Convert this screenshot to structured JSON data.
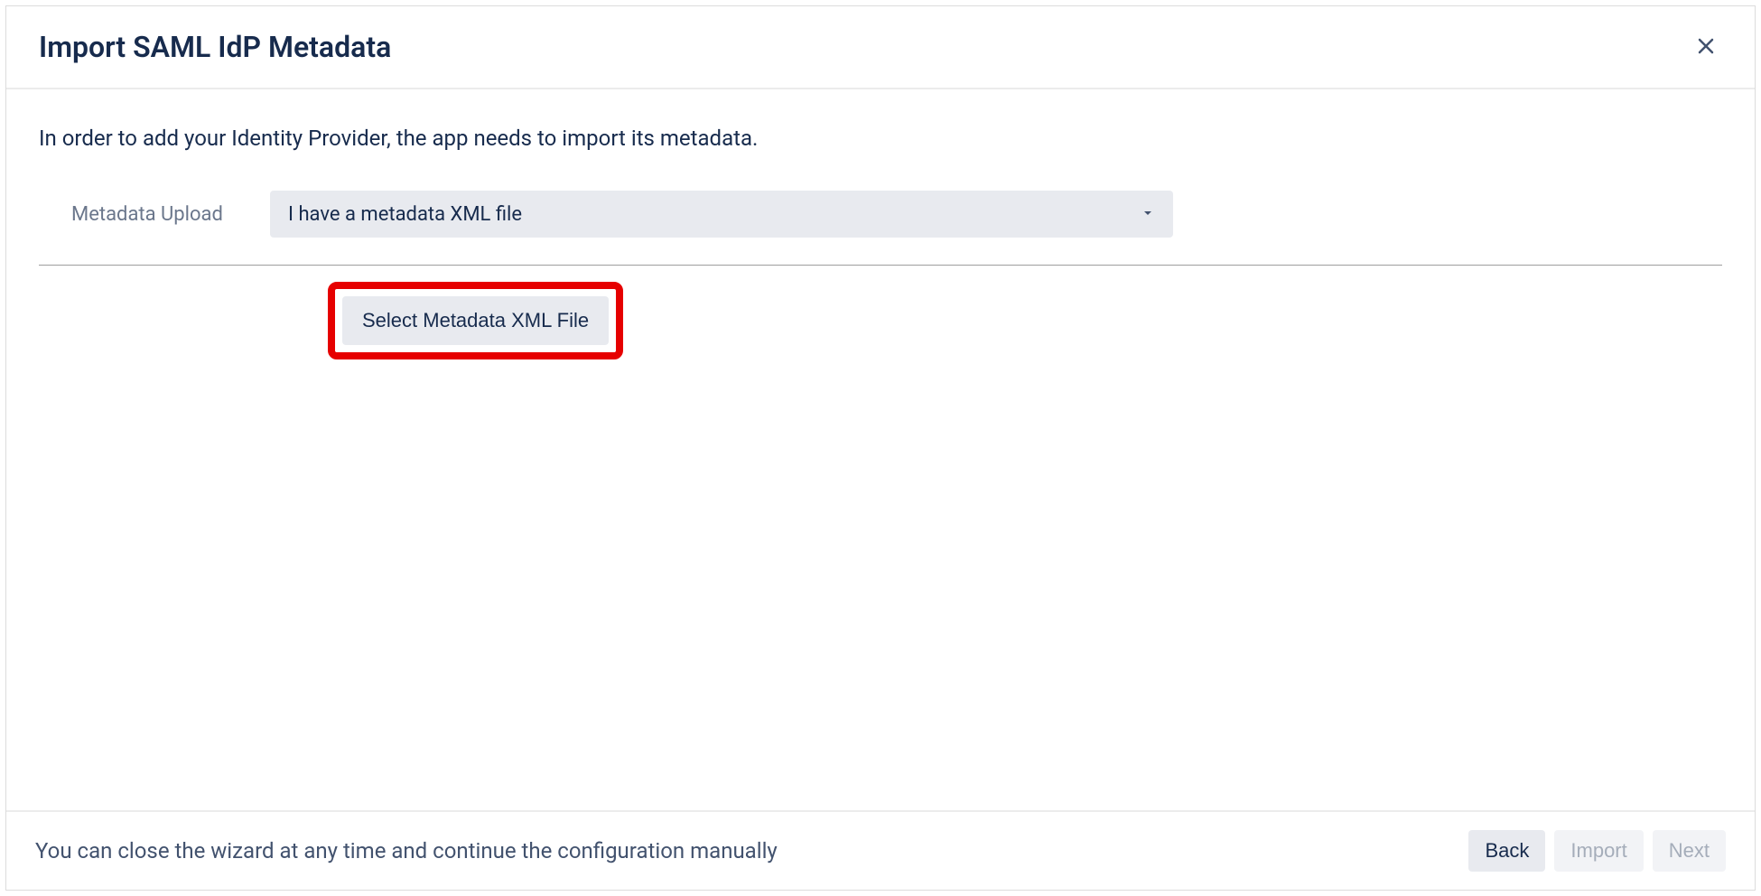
{
  "dialog": {
    "title": "Import SAML IdP Metadata",
    "instruction": "In order to add your Identity Provider, the app needs to import its metadata.",
    "upload_label": "Metadata Upload",
    "dropdown_value": "I have a metadata XML file",
    "select_file_button": "Select Metadata XML File"
  },
  "footer": {
    "hint": "You can close the wizard at any time and continue the configuration manually",
    "back_label": "Back",
    "import_label": "Import",
    "next_label": "Next"
  }
}
